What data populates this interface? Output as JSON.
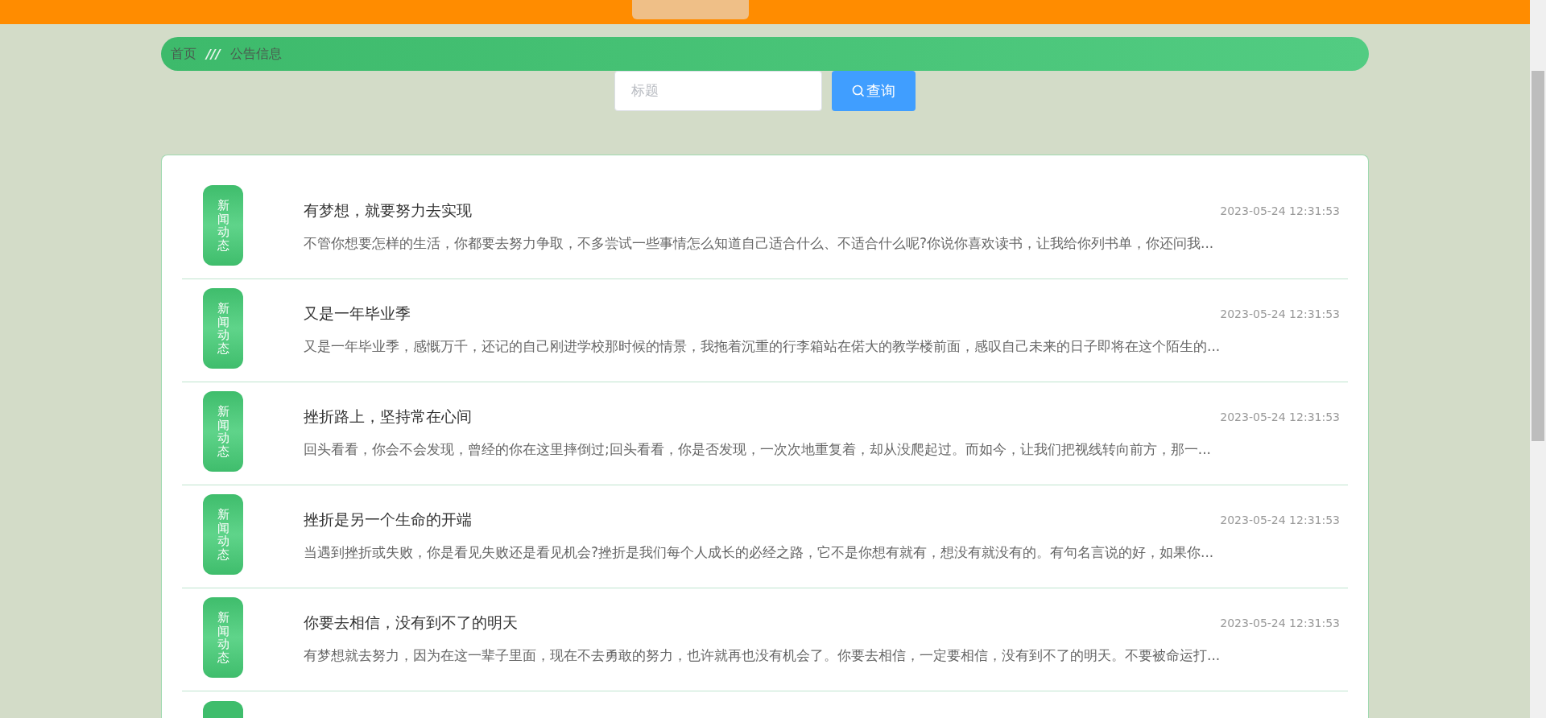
{
  "breadcrumb": [
    {
      "label": "首页"
    },
    {
      "label": "公告信息"
    }
  ],
  "breadcrumb_separator": "///",
  "search": {
    "placeholder": "标题",
    "button": "查询"
  },
  "notices": [
    {
      "badge": "新闻动态",
      "title": "有梦想，就要努力去实现",
      "time": "2023-05-24 12:31:53",
      "summary": "不管你想要怎样的生活，你都要去努力争取，不多尝试一些事情怎么知道自己适合什么、不适合什么呢?你说你喜欢读书，让我给你列书单，你还问我..."
    },
    {
      "badge": "新闻动态",
      "title": "又是一年毕业季",
      "time": "2023-05-24 12:31:53",
      "summary": "又是一年毕业季，感慨万千，还记的自己刚进学校那时候的情景，我拖着沉重的行李箱站在偌大的教学楼前面，感叹自己未来的日子即将在这个陌生的..."
    },
    {
      "badge": "新闻动态",
      "title": "挫折路上，坚持常在心间",
      "time": "2023-05-24 12:31:53",
      "summary": "回头看看，你会不会发现，曾经的你在这里摔倒过;回头看看，你是否发现，一次次地重复着，却从没爬起过。而如今，让我们把视线转向前方，那一..."
    },
    {
      "badge": "新闻动态",
      "title": "挫折是另一个生命的开端",
      "time": "2023-05-24 12:31:53",
      "summary": "当遇到挫折或失败，你是看见失败还是看见机会?挫折是我们每个人成长的必经之路，它不是你想有就有，想没有就没有的。有句名言说的好，如果你..."
    },
    {
      "badge": "新闻动态",
      "title": "你要去相信，没有到不了的明天",
      "time": "2023-05-24 12:31:53",
      "summary": "有梦想就去努力，因为在这一辈子里面，现在不去勇敢的努力，也许就再也没有机会了。你要去相信，一定要相信，没有到不了的明天。不要被命运打..."
    }
  ],
  "more_below": true
}
